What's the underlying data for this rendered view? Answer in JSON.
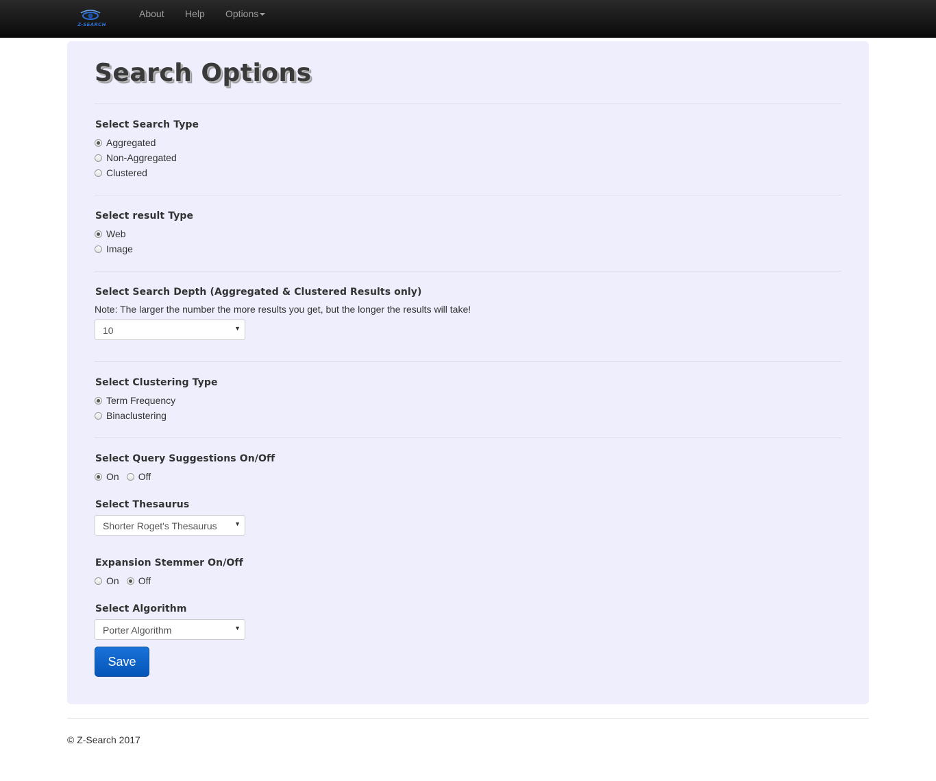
{
  "nav": {
    "logo_text": "Z-SEARCH",
    "about": "About",
    "help": "Help",
    "options": "Options"
  },
  "page": {
    "title": "Search Options"
  },
  "search_type": {
    "label": "Select Search Type",
    "options": [
      "Aggregated",
      "Non-Aggregated",
      "Clustered"
    ],
    "selected": "Aggregated"
  },
  "result_type": {
    "label": "Select result Type",
    "options": [
      "Web",
      "Image"
    ],
    "selected": "Web"
  },
  "search_depth": {
    "label": "Select Search Depth (Aggregated & Clustered Results only)",
    "note": "Note: The larger the number the more results you get, but the longer the results will take!",
    "value": "10"
  },
  "clustering_type": {
    "label": "Select Clustering Type",
    "options": [
      "Term Frequency",
      "Binaclustering"
    ],
    "selected": "Term Frequency"
  },
  "query_suggestions": {
    "label": "Select Query Suggestions On/Off",
    "options": [
      "On",
      "Off"
    ],
    "selected": "On"
  },
  "thesaurus": {
    "label": "Select Thesaurus",
    "value": "Shorter Roget's Thesaurus"
  },
  "expansion_stemmer": {
    "label": "Expansion Stemmer On/Off",
    "options": [
      "On",
      "Off"
    ],
    "selected": "Off"
  },
  "algorithm": {
    "label": "Select Algorithm",
    "value": "Porter Algorithm"
  },
  "save_label": "Save",
  "footer": "© Z-Search 2017"
}
